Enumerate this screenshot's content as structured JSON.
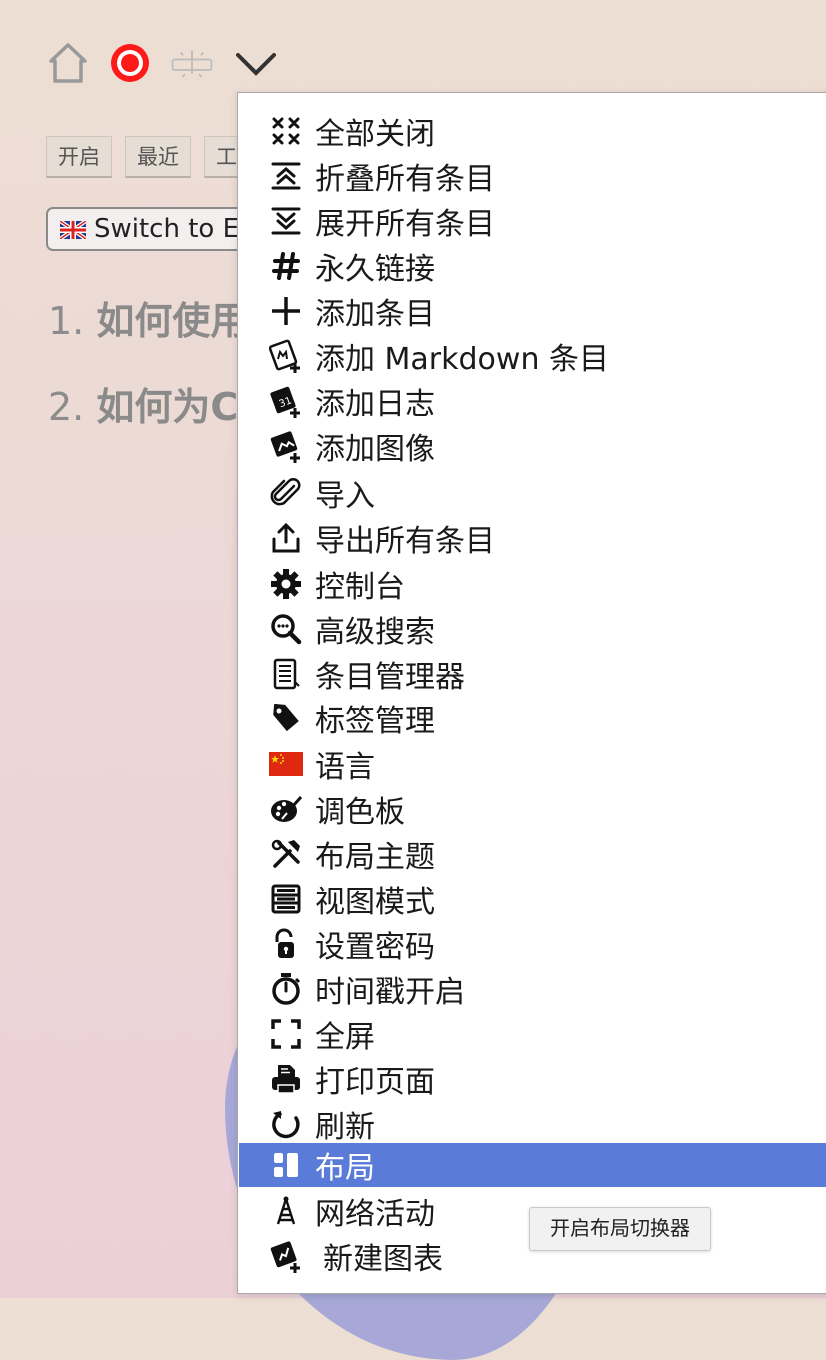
{
  "toolbar": {
    "icons": [
      "home-icon",
      "record-icon",
      "sparkle-icon",
      "chevron-down-icon"
    ],
    "record_color": "#ff1a1a"
  },
  "tabs": [
    "开启",
    "最近",
    "工"
  ],
  "lang_button": {
    "label": "Switch to E",
    "flag": "uk-flag-icon"
  },
  "headings": [
    {
      "num": "1.",
      "text": "如何使用"
    },
    {
      "num": "2.",
      "text": "如何为C"
    }
  ],
  "menu": {
    "items": [
      {
        "label": "全部关闭",
        "icon": "close-all-icon"
      },
      {
        "label": "折叠所有条目",
        "icon": "collapse-all-icon"
      },
      {
        "label": "展开所有条目",
        "icon": "expand-all-icon"
      },
      {
        "label": "永久链接",
        "icon": "hashtag-icon"
      },
      {
        "label": "添加条目",
        "icon": "plus-icon"
      },
      {
        "label": "添加 Markdown 条目",
        "icon": "markdown-add-icon"
      },
      {
        "label": "添加日志",
        "icon": "journal-add-icon"
      },
      {
        "label": "添加图像",
        "icon": "image-add-icon"
      },
      {
        "label": "导入",
        "icon": "paperclip-icon"
      },
      {
        "label": "导出所有条目",
        "icon": "export-icon"
      },
      {
        "label": "控制台",
        "icon": "gear-icon"
      },
      {
        "label": "高级搜索",
        "icon": "advanced-search-icon"
      },
      {
        "label": "条目管理器",
        "icon": "list-manager-icon"
      },
      {
        "label": "标签管理",
        "icon": "tag-icon"
      },
      {
        "label": "语言",
        "icon": "china-flag-icon"
      },
      {
        "label": "调色板",
        "icon": "palette-icon"
      },
      {
        "label": "布局主题",
        "icon": "theme-tools-icon"
      },
      {
        "label": "视图模式",
        "icon": "view-mode-icon"
      },
      {
        "label": "设置密码",
        "icon": "unlock-icon"
      },
      {
        "label": "时间戳开启",
        "icon": "stopwatch-icon"
      },
      {
        "label": "全屏",
        "icon": "fullscreen-icon"
      },
      {
        "label": "打印页面",
        "icon": "print-icon"
      },
      {
        "label": "刷新",
        "icon": "refresh-icon"
      },
      {
        "label": "布局",
        "icon": "layout-icon",
        "active": true
      },
      {
        "label": "网络活动",
        "icon": "network-activity-icon"
      },
      {
        "label": "新建图表",
        "icon": "new-chart-icon"
      }
    ],
    "active_color": "#5a7bd8"
  },
  "tooltip": {
    "text": "开启布局切换器"
  }
}
